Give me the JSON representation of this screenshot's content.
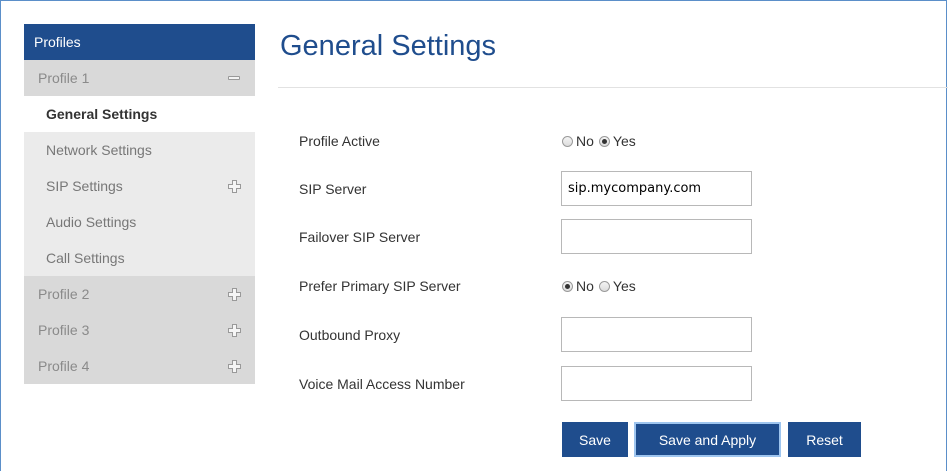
{
  "sidebar": {
    "header": "Profiles",
    "profile1": {
      "label": "Profile 1",
      "items": [
        {
          "label": "General Settings"
        },
        {
          "label": "Network Settings"
        },
        {
          "label": "SIP Settings"
        },
        {
          "label": "Audio Settings"
        },
        {
          "label": "Call Settings"
        }
      ]
    },
    "profile2": {
      "label": "Profile 2"
    },
    "profile3": {
      "label": "Profile 3"
    },
    "profile4": {
      "label": "Profile 4"
    }
  },
  "main": {
    "title": "General Settings",
    "fields": {
      "profile_active": {
        "label": "Profile Active",
        "options": [
          "No",
          "Yes"
        ],
        "selected": "Yes"
      },
      "sip_server": {
        "label": "SIP Server",
        "value": "sip.mycompany.com"
      },
      "failover_sip_server": {
        "label": "Failover SIP Server",
        "value": ""
      },
      "prefer_primary": {
        "label": "Prefer Primary SIP Server",
        "options": [
          "No",
          "Yes"
        ],
        "selected": "No"
      },
      "outbound_proxy": {
        "label": "Outbound Proxy",
        "value": ""
      },
      "voice_mail": {
        "label": "Voice Mail Access Number",
        "value": ""
      }
    },
    "buttons": {
      "save": "Save",
      "save_apply": "Save and Apply",
      "reset": "Reset"
    }
  },
  "colors": {
    "brand": "#1f4d8d",
    "frame_border": "#5b8fc9",
    "sidebar_profile_bg": "#d9d9d9",
    "sidebar_sub_bg": "#ebebeb"
  },
  "icons": {
    "collapse": "minus-icon",
    "expand": "plus-icon"
  }
}
